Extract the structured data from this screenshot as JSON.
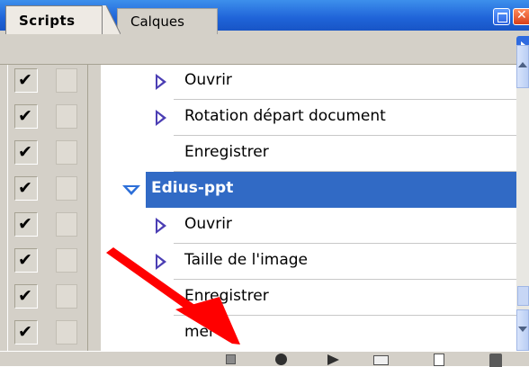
{
  "tabs": [
    {
      "label": "Scripts",
      "active": true
    },
    {
      "label": "Calques",
      "active": false
    }
  ],
  "rows": [
    {
      "label": "Ouvrir",
      "level": 2,
      "expander": "collapsed",
      "checked": true
    },
    {
      "label": "Rotation départ document",
      "level": 2,
      "expander": "collapsed",
      "checked": true
    },
    {
      "label": "Enregistrer",
      "level": 2,
      "expander": "none",
      "checked": true
    },
    {
      "label": "Edius-ppt",
      "level": 1,
      "expander": "expanded",
      "checked": true,
      "selected": true
    },
    {
      "label": "Ouvrir",
      "level": 2,
      "expander": "collapsed",
      "checked": true
    },
    {
      "label": "Taille de l'image",
      "level": 2,
      "expander": "collapsed",
      "checked": true
    },
    {
      "label": "Enregistrer",
      "level": 2,
      "expander": "none",
      "checked": true
    },
    {
      "label": "mer",
      "level": 2,
      "expander": "none",
      "checked": true
    }
  ],
  "toolbar": {
    "buttons": [
      "stop-icon",
      "record-icon",
      "play-icon",
      "new-set-folder-icon",
      "new-action-icon",
      "trash-icon"
    ]
  },
  "colors": {
    "titlebar": "#2563dc",
    "selection": "#316ac5",
    "annotation_arrow": "#ff0000",
    "expander": "#4b3eb4"
  }
}
